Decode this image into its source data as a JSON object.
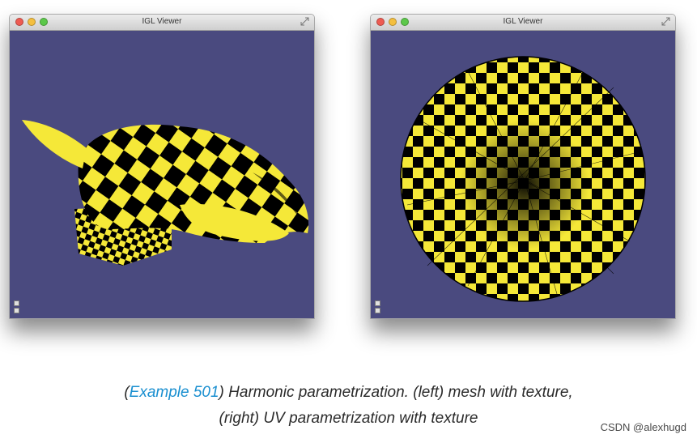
{
  "windows": {
    "left": {
      "title": "IGL Viewer",
      "description": "mesh with texture"
    },
    "right": {
      "title": "IGL Viewer",
      "description": "UV parametrization with texture"
    }
  },
  "caption": {
    "open_paren": "(",
    "link": "Example 501",
    "line1_rest": ") Harmonic parametrization. (left) mesh with texture,",
    "line2": "(right) UV parametrization with texture"
  },
  "watermark": "CSDN @alexhugd",
  "colors": {
    "viewport_bg": "#4a4a7f",
    "checker_yellow": "#f5e838",
    "checker_black": "#000000",
    "link": "#1a8fd0"
  }
}
